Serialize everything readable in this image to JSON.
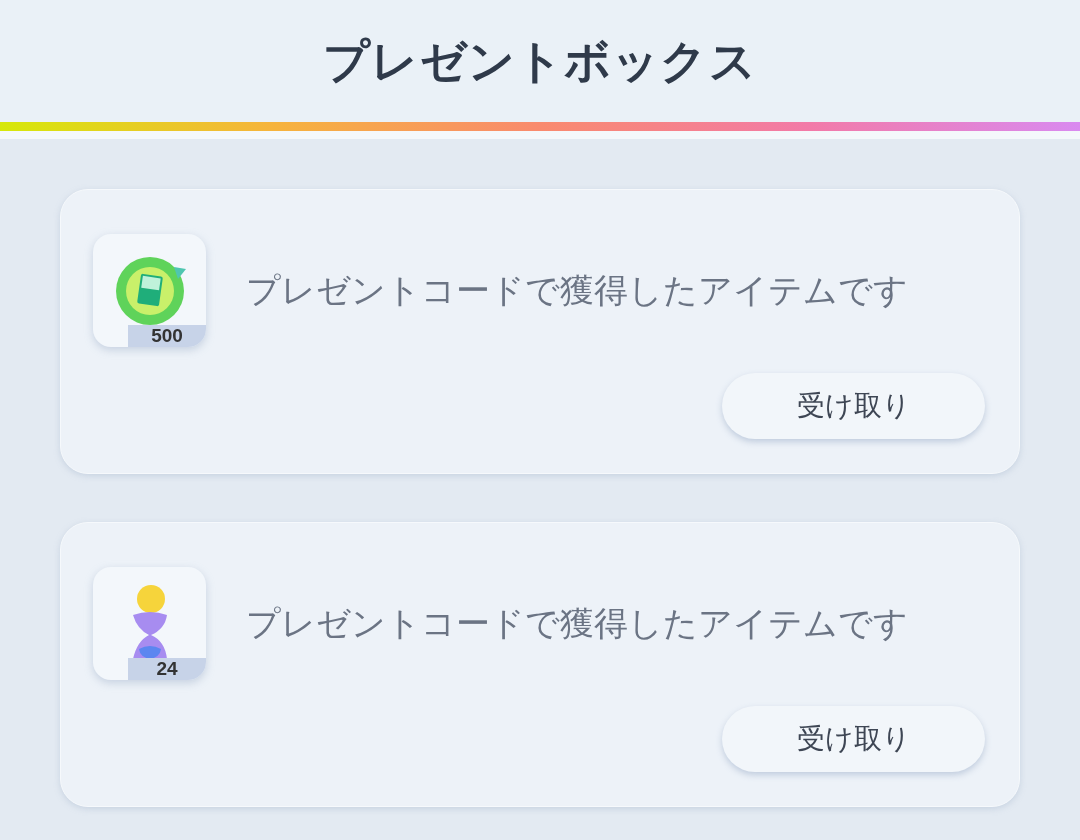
{
  "header": {
    "title": "プレゼントボックス"
  },
  "gifts": [
    {
      "kind": "refresh",
      "count": "500",
      "message": "プレゼントコードで獲得したアイテムです",
      "button": "受け取り"
    },
    {
      "kind": "hourglass",
      "count": "24",
      "message": "プレゼントコードで獲得したアイテムです",
      "button": "受け取り"
    }
  ]
}
